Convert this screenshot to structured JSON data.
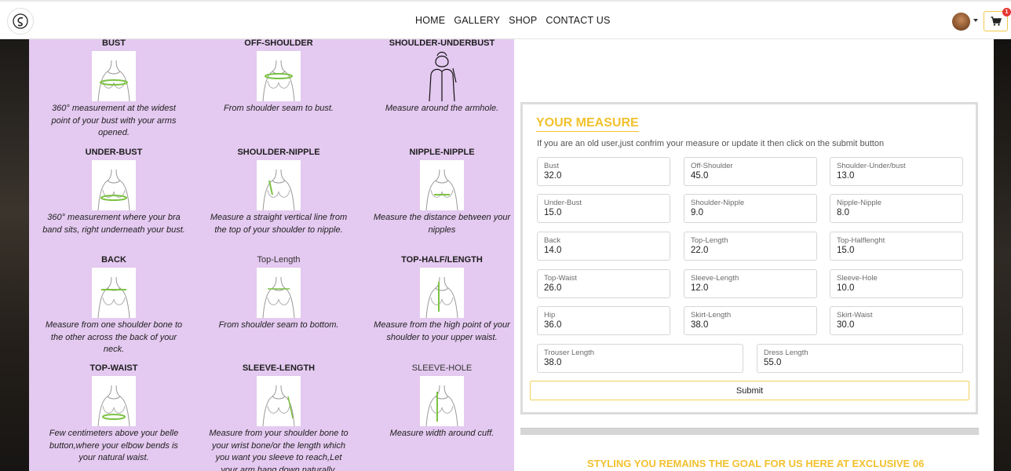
{
  "nav": {
    "links": [
      "HOME",
      "GALLERY",
      "SHOP",
      "CONTACT US"
    ],
    "cart_count": "1"
  },
  "guide": [
    {
      "title": "BUST",
      "bold": true,
      "desc": "360° measurement at the widest point of your bust with your arms opened."
    },
    {
      "title": "OFF-SHOULDER",
      "bold": true,
      "desc": "From shoulder seam to bust."
    },
    {
      "title": "SHOULDER-UNDERBUST",
      "bold": true,
      "desc": "Measure around the armhole."
    },
    {
      "title": "UNDER-BUST",
      "bold": true,
      "desc": "360° measurement where your bra band sits, right underneath your bust."
    },
    {
      "title": "SHOULDER-NIPPLE",
      "bold": true,
      "desc": "Measure a straight vertical line from the top of your shoulder to nipple."
    },
    {
      "title": "NIPPLE-NIPPLE",
      "bold": true,
      "desc": "Measure the distance between your nipples"
    },
    {
      "title": "BACK",
      "bold": true,
      "desc": "Measure from one shoulder bone to the other across the back of your neck."
    },
    {
      "title": "Top-Length",
      "bold": false,
      "desc": "From shoulder seam to bottom."
    },
    {
      "title": "TOP-HALF/LENGTH",
      "bold": true,
      "desc": "Measure from the high point of your shoulder to your upper waist."
    },
    {
      "title": "TOP-WAIST",
      "bold": true,
      "desc": "Few centimeters above your belle button,where your elbow bends is your natural waist."
    },
    {
      "title": "SLEEVE-LENGTH",
      "bold": true,
      "desc": "Measure from your shoulder bone to your wrist bone/or the length which you want you sleeve to reach,Let your arm hang down naturally."
    },
    {
      "title": "SLEEVE-HOLE",
      "bold": false,
      "desc": "Measure width around cuff."
    }
  ],
  "measure": {
    "title": "YOUR MEASURE",
    "description": "If you are an old user,just confrim your measure or update it then click on the submit button",
    "fields": [
      {
        "label": "Bust",
        "value": "32.0"
      },
      {
        "label": "Off-Shoulder",
        "value": "45.0"
      },
      {
        "label": "Shoulder-Under/bust",
        "value": "13.0"
      },
      {
        "label": "Under-Bust",
        "value": "15.0"
      },
      {
        "label": "Shoulder-Nipple",
        "value": "9.0"
      },
      {
        "label": "Nipple-Nipple",
        "value": "8.0"
      },
      {
        "label": "Back",
        "value": "14.0"
      },
      {
        "label": "Top-Length",
        "value": "22.0"
      },
      {
        "label": "Top-Halflenght",
        "value": "15.0"
      },
      {
        "label": "Top-Waist",
        "value": "26.0"
      },
      {
        "label": "Sleeve-Length",
        "value": "12.0"
      },
      {
        "label": "Sleeve-Hole",
        "value": "10.0"
      },
      {
        "label": "Hip",
        "value": "36.0"
      },
      {
        "label": "Skirt-Length",
        "value": "38.0"
      },
      {
        "label": "Skirt-Waist",
        "value": "30.0"
      },
      {
        "label": "Trouser Length",
        "value": "38.0"
      },
      {
        "label": "Dress Length",
        "value": "55.0"
      }
    ],
    "submit_label": "Submit"
  },
  "tagline": "STYLING YOU REMAINS THE GOAL FOR US HERE AT EXCLUSIVE 06",
  "colors": {
    "accent": "#f2c12e",
    "guide_bg": "#e4c9f0",
    "measure_line": "#7cc242"
  }
}
